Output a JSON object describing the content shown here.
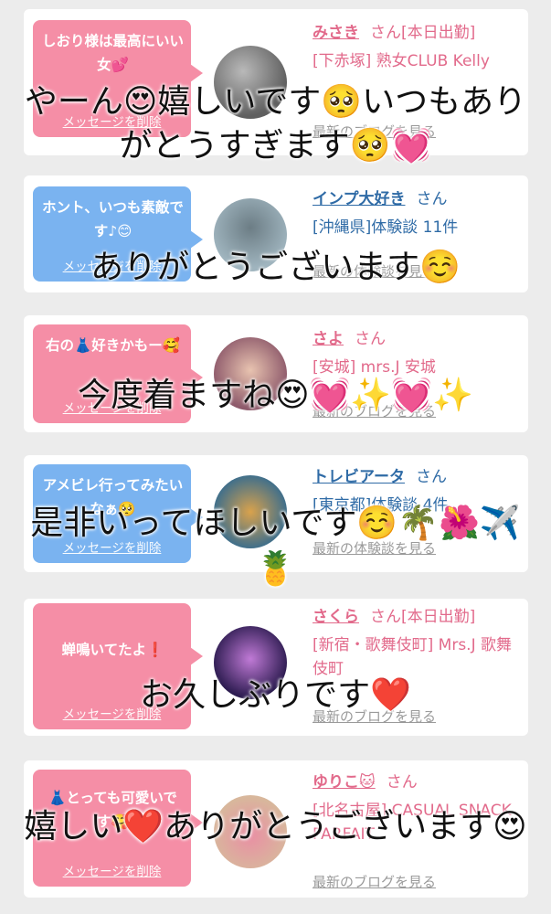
{
  "messages": [
    {
      "bubble_text": "しおり様は最高にいい女💕",
      "delete_label": "メッセージを削除",
      "name": "みさき",
      "honorific": "さん[本日出勤]",
      "area_shop": "[下赤塚] 熟女CLUB Kelly",
      "blog_link": "最新のブログを見る",
      "overlay": "やーん😍嬉しいです🥺いつもありがとうすぎます🥺💓"
    },
    {
      "bubble_text": "ホント、いつも素敵です♪😊",
      "delete_label": "メッセージを削除",
      "name": "インプ大好き",
      "honorific": "さん",
      "area_shop": "[沖縄県]体験談 11件",
      "blog_link": "最新の体験談を見る",
      "overlay": "ありがとうございます☺️"
    },
    {
      "bubble_text": "右の👗好きかもー🥰",
      "delete_label": "メッセージを削除",
      "name": "さよ",
      "honorific": "さん",
      "area_shop": "[安城] mrs.J 安城",
      "blog_link": "最新のブログを見る",
      "overlay": "今度着ますね😍💓✨💓✨"
    },
    {
      "bubble_text": "アメビレ行ってみたいなぁ🥺",
      "delete_label": "メッセージを削除",
      "name": "トレビアータ",
      "honorific": "さん",
      "area_shop": "[東京都]体験談 4件",
      "blog_link": "最新の体験談を見る",
      "overlay": "是非いってほしいです☺️🌴🌺✈️🍍"
    },
    {
      "bubble_text": "蝉鳴いてたよ❗️",
      "delete_label": "メッセージを削除",
      "name": "さくら",
      "honorific": "さん[本日出勤]",
      "area_shop": "[新宿・歌舞伎町] Mrs.J 歌舞伎町",
      "blog_link": "最新のブログを見る",
      "overlay": "お久しぶりです❤️"
    },
    {
      "bubble_text": "👗とっても可愛いです🥰",
      "delete_label": "メッセージを削除",
      "name": "ゆりこ🐱",
      "honorific": "さん",
      "area_shop": "[北名古屋] CASUAL SNACK PARFAIT",
      "blog_link": "最新のブログを見る",
      "overlay": "嬉しい❤️ありがとうございます😍"
    }
  ],
  "colors": {
    "pink_bubble": "#f58ea6",
    "blue_bubble": "#7ab3f0",
    "pink_text": "#e26a8b",
    "blue_text": "#2f6ba6",
    "background": "#ececec"
  }
}
